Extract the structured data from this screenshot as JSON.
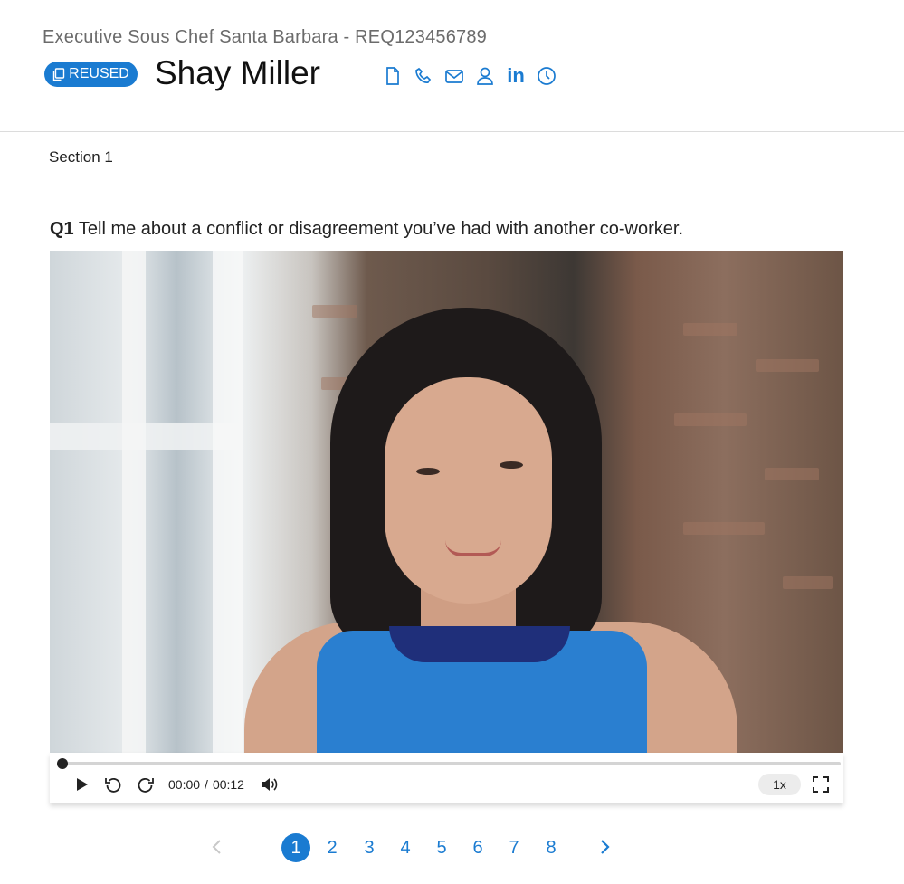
{
  "header": {
    "job_title": "Executive Sous Chef Santa Barbara - REQ123456789",
    "badge_label": "REUSED",
    "candidate_name": "Shay Miller",
    "contact_icons": [
      "document-icon",
      "phone-icon",
      "mail-icon",
      "profile-icon",
      "linkedin-icon",
      "history-icon"
    ],
    "linkedin_text": "in"
  },
  "section": {
    "label": "Section 1"
  },
  "question": {
    "number": "Q1",
    "text": "Tell me about a conflict or disagreement you’ve had with another co-worker."
  },
  "player": {
    "current_time": "00:00",
    "separator": "/",
    "duration": "00:12",
    "progress_fraction": 0,
    "speed": "1x",
    "icons": [
      "play-icon",
      "rewind-icon",
      "forward-icon",
      "volume-icon",
      "fullscreen-icon"
    ]
  },
  "pagination": {
    "pages": [
      "1",
      "2",
      "3",
      "4",
      "5",
      "6",
      "7",
      "8"
    ],
    "active_page": "1",
    "prev_disabled": true
  },
  "colors": {
    "accent": "#1a7bd1",
    "text": "#222222",
    "muted": "#6b6b6b"
  }
}
